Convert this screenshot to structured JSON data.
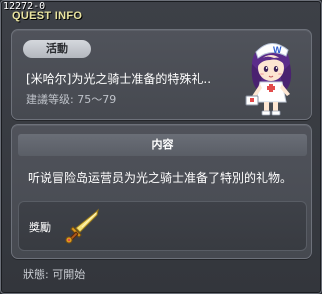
{
  "window": {
    "quest_id": "12272-0",
    "title": "QUEST INFO"
  },
  "quest": {
    "category": "活動",
    "title": "[米哈尔]为光之骑士准备的特殊礼",
    "title_ellipsis": "..",
    "level_label": "建議等级:",
    "level_range": "75～79"
  },
  "details": {
    "section_title": "内容",
    "description": "听说冒险岛运营员为光之骑士准备了特別的礼物。",
    "reward_label": "獎勵",
    "reward_item_icon": "golden-sword-icon"
  },
  "status": {
    "label": "狀態:",
    "value": "可開始"
  },
  "colors": {
    "title_text": "#e9e4a0",
    "panel_bg": "#4b4e55",
    "badge_bg": "#c4c7cd"
  }
}
